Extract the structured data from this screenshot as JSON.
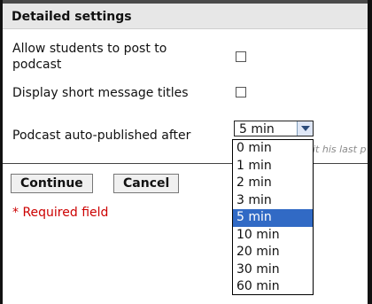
{
  "section": {
    "title": "Detailed settings"
  },
  "settings": {
    "allow_post_label": "Allow students to post to podcast",
    "short_titles_label": "Display short message titles",
    "autopublish_label": "Podcast auto-published after",
    "selected_value": "5 min",
    "hint_text": "it his last p"
  },
  "options": [
    "0 min",
    "1 min",
    "2 min",
    "3 min",
    "5 min",
    "10 min",
    "20 min",
    "30 min",
    "60 min"
  ],
  "buttons": {
    "continue": "Continue",
    "cancel": "Cancel"
  },
  "required_note": "* Required field"
}
